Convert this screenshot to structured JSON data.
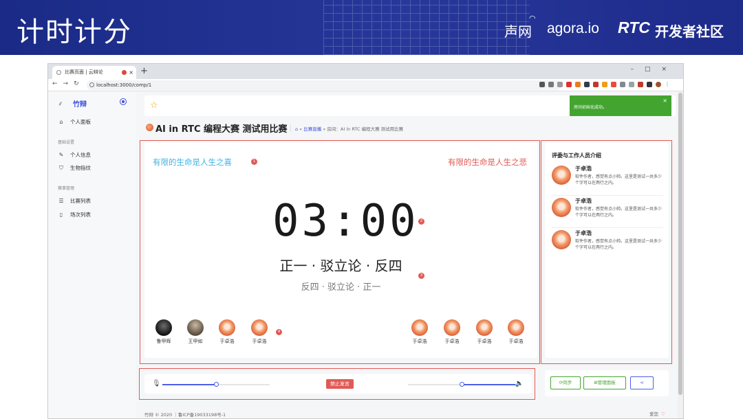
{
  "slide": {
    "title": "计时计分",
    "logo_shengwang": "声网",
    "logo_agora": "agora.io",
    "logo_rtc": "RTC",
    "logo_rtc_suffix": "开发者社区"
  },
  "browser": {
    "tab_title": "比赛页面 | 云辩论",
    "tab_close": "×",
    "new_tab": "+",
    "url": "localhost:3000/comp/1"
  },
  "sidebar": {
    "brand": "竹辩",
    "items": [
      {
        "label": "个人面板",
        "icon": "home-icon"
      },
      {
        "label": "个人信息",
        "icon": "edit-icon"
      },
      {
        "label": "生物指纹",
        "icon": "shield-icon"
      },
      {
        "label": "比赛列表",
        "icon": "list-icon"
      },
      {
        "label": "场次列表",
        "icon": "document-icon"
      }
    ],
    "groups": [
      "基础设置",
      "赛事管理"
    ]
  },
  "toast": {
    "message": "房间初始化成功。",
    "close": "×"
  },
  "competition": {
    "title": "AI in RTC 编程大赛 测试用比赛",
    "breadcrumb_sep": "»",
    "breadcrumb_link": "比赛直播",
    "breadcrumb_current": "房间：AI in RTC 编程大赛 测试用比赛"
  },
  "debate": {
    "affirmative": "有限的生命是人生之喜",
    "negative": "有限的生命是人生之悲",
    "timer": "03:00",
    "stage_main": "正一 · 驳立论 · 反四",
    "stage_sub": "反四 · 驳立论 · 正一",
    "badges": [
      "1",
      "2",
      "3",
      "4"
    ],
    "left_team": [
      {
        "name": "鲁甲晖",
        "avatar": "dark"
      },
      {
        "name": "王甲如",
        "avatar": "photo"
      },
      {
        "name": "于卓浩",
        "avatar": "fire"
      },
      {
        "name": "于卓浩",
        "avatar": "fire"
      }
    ],
    "right_team": [
      {
        "name": "于卓浩",
        "avatar": "fire"
      },
      {
        "name": "于卓浩",
        "avatar": "fire"
      },
      {
        "name": "于卓浩",
        "avatar": "fire"
      },
      {
        "name": "于卓浩",
        "avatar": "fire"
      }
    ]
  },
  "judges": {
    "title": "评委与工作人员介绍",
    "items": [
      {
        "name": "于卓浩",
        "desc": "软件作者，感觉有点小帅。这里是测试一共多少个字可以在两行之内。"
      },
      {
        "name": "于卓浩",
        "desc": "软件作者，感觉有点小帅。这里是测试一共多少个字可以在两行之内。"
      },
      {
        "name": "于卓浩",
        "desc": "软件作者，感觉有点小帅。这里是测试一共多少个字可以在两行之内。"
      }
    ]
  },
  "controls": {
    "mute_label": "禁止发言",
    "mic_volume": 0.5,
    "speaker_volume": 0.5
  },
  "actions": {
    "sync_label": "同步",
    "panel_label": "管理面板",
    "share_icon": "share-icon"
  },
  "footer": {
    "copyright": "竹辩 © 2020 ｜鲁ICP备19033198号-1",
    "love": "爱您"
  },
  "colors": {
    "header_blue": "#1f2f8e",
    "accent_blue": "#3a4ed6",
    "affirmative": "#3cb4e6",
    "negative": "#e05a55",
    "toast_green": "#43a52f"
  }
}
